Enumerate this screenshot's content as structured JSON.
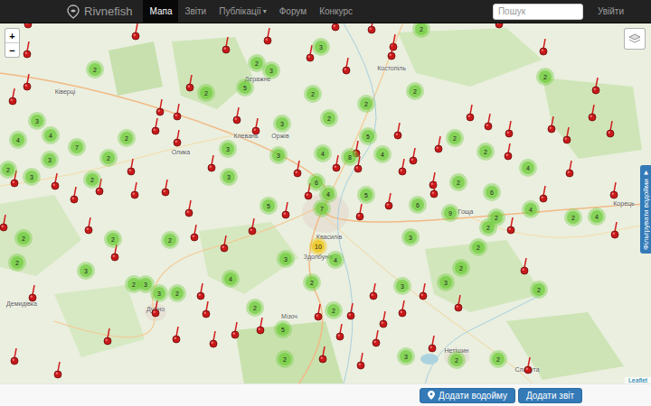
{
  "navbar": {
    "brand": "Rivnefish",
    "items": [
      {
        "label": "Мапа",
        "selected": true,
        "caret": ""
      },
      {
        "label": "Звіти",
        "selected": false,
        "caret": ""
      },
      {
        "label": "Публікації",
        "selected": false,
        "caret": "▾"
      },
      {
        "label": "Форум",
        "selected": false,
        "caret": ""
      },
      {
        "label": "Конкурс",
        "selected": false,
        "caret": ""
      }
    ],
    "search": {
      "placeholder": "Пошук"
    },
    "login": "Увійти"
  },
  "map": {
    "zoom": [
      "+",
      "−"
    ],
    "filter_tab": "Фільтрувати водойми ▼",
    "attribution": "Leaflet",
    "places": [
      "Ківерці",
      "Деражне",
      "Костопіль",
      "Олика",
      "Клевань",
      "Оржів",
      "Квасилів",
      "Здолбунів",
      "Гоща",
      "Корець",
      "Дубно",
      "Мізоч",
      "Нетішин",
      "Славута",
      "Демидівка"
    ],
    "clusters": [
      {
        "count": "2",
        "color": "#6ecc39"
      },
      {
        "count": "3",
        "color": "#6ecc39"
      },
      {
        "count": "2",
        "color": "#6ecc39"
      },
      {
        "count": "2",
        "color": "#6ecc39"
      },
      {
        "count": "3",
        "color": "#6ecc39"
      },
      {
        "count": "5",
        "color": "#6ecc39"
      },
      {
        "count": "2",
        "color": "#6ecc39"
      },
      {
        "count": "2",
        "color": "#6ecc39"
      },
      {
        "count": "2",
        "color": "#6ecc39"
      },
      {
        "count": "2",
        "color": "#6ecc39"
      },
      {
        "count": "2",
        "color": "#6ecc39"
      },
      {
        "count": "2",
        "color": "#6ecc39"
      },
      {
        "count": "3",
        "color": "#6ecc39"
      },
      {
        "count": "3",
        "color": "#6ecc39"
      },
      {
        "count": "4",
        "color": "#6ecc39"
      },
      {
        "count": "4",
        "color": "#6ecc39"
      },
      {
        "count": "7",
        "color": "#6ecc39"
      },
      {
        "count": "2",
        "color": "#6ecc39"
      },
      {
        "count": "5",
        "color": "#6ecc39"
      },
      {
        "count": "2",
        "color": "#6ecc39"
      },
      {
        "count": "2",
        "color": "#6ecc39"
      },
      {
        "count": "2",
        "color": "#6ecc39"
      },
      {
        "count": "3",
        "color": "#6ecc39"
      },
      {
        "count": "3",
        "color": "#6ecc39"
      },
      {
        "count": "3",
        "color": "#6ecc39"
      },
      {
        "count": "4",
        "color": "#6ecc39"
      },
      {
        "count": "8",
        "color": "#6ecc39"
      },
      {
        "count": "4",
        "color": "#6ecc39"
      },
      {
        "count": "2",
        "color": "#6ecc39"
      },
      {
        "count": "3",
        "color": "#6ecc39"
      },
      {
        "count": "2",
        "color": "#6ecc39"
      },
      {
        "count": "3",
        "color": "#6ecc39"
      },
      {
        "count": "6",
        "color": "#6ecc39"
      },
      {
        "count": "4",
        "color": "#6ecc39"
      },
      {
        "count": "5",
        "color": "#6ecc39"
      },
      {
        "count": "2",
        "color": "#6ecc39"
      },
      {
        "count": "4",
        "color": "#6ecc39"
      },
      {
        "count": "6",
        "color": "#6ecc39"
      },
      {
        "count": "5",
        "color": "#6ecc39"
      },
      {
        "count": "7",
        "color": "#6ecc39"
      },
      {
        "count": "6",
        "color": "#6ecc39"
      },
      {
        "count": "9",
        "color": "#6ecc39"
      },
      {
        "count": "4",
        "color": "#6ecc39"
      },
      {
        "count": "2",
        "color": "#6ecc39"
      },
      {
        "count": "2",
        "color": "#6ecc39"
      },
      {
        "count": "2",
        "color": "#6ecc39"
      },
      {
        "count": "4",
        "color": "#6ecc39"
      },
      {
        "count": "2",
        "color": "#6ecc39"
      },
      {
        "count": "2",
        "color": "#6ecc39"
      },
      {
        "count": "2",
        "color": "#6ecc39"
      },
      {
        "count": "3",
        "color": "#6ecc39"
      },
      {
        "count": "10",
        "color": "#f0c20c"
      },
      {
        "count": "3",
        "color": "#6ecc39"
      },
      {
        "count": "4",
        "color": "#6ecc39"
      },
      {
        "count": "2",
        "color": "#6ecc39"
      },
      {
        "count": "2",
        "color": "#6ecc39"
      },
      {
        "count": "3",
        "color": "#6ecc39"
      },
      {
        "count": "2",
        "color": "#6ecc39"
      },
      {
        "count": "4",
        "color": "#6ecc39"
      },
      {
        "count": "2",
        "color": "#6ecc39"
      },
      {
        "count": "3",
        "color": "#6ecc39"
      },
      {
        "count": "3",
        "color": "#6ecc39"
      },
      {
        "count": "2",
        "color": "#6ecc39"
      },
      {
        "count": "2",
        "color": "#6ecc39"
      },
      {
        "count": "3",
        "color": "#6ecc39"
      },
      {
        "count": "3",
        "color": "#6ecc39"
      },
      {
        "count": "2",
        "color": "#6ecc39"
      },
      {
        "count": "2",
        "color": "#6ecc39"
      },
      {
        "count": "2",
        "color": "#6ecc39"
      },
      {
        "count": "5",
        "color": "#6ecc39"
      },
      {
        "count": "3",
        "color": "#6ecc39"
      },
      {
        "count": "2",
        "color": "#6ecc39"
      },
      {
        "count": "2",
        "color": "#6ecc39"
      },
      {
        "count": "2",
        "color": "#6ecc39"
      }
    ]
  },
  "actions": [
    "Додати водойму",
    "Додати звіт"
  ]
}
